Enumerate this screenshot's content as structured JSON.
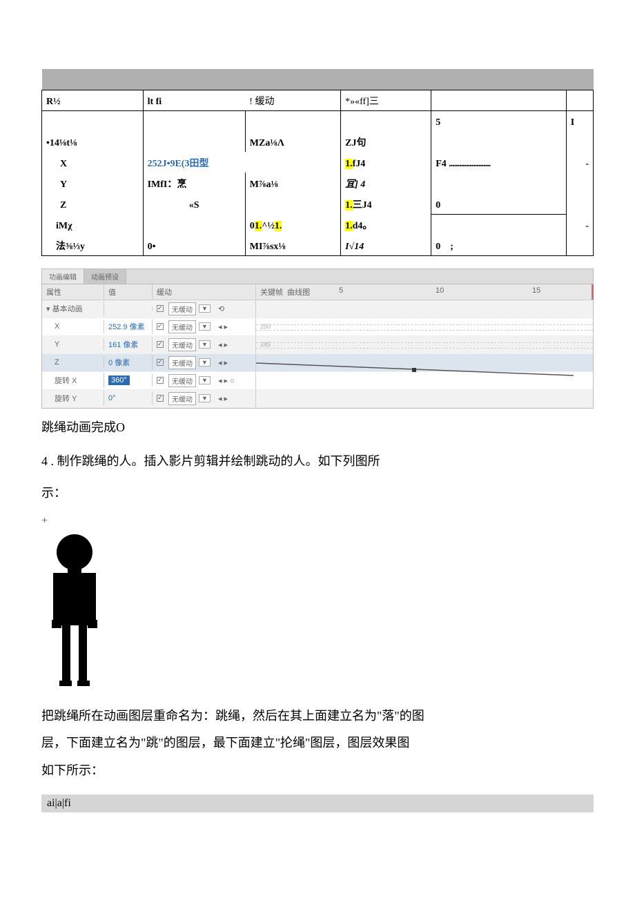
{
  "top_table": {
    "header_left": "R½",
    "header_mid1": "lt fi",
    "header_mid2": "! 缓动",
    "header_right": "*»«ff]三",
    "row0_right": "5",
    "row1_c1": "•14⅛t⅛",
    "row1_c3": "MZa⅛Λ",
    "row1_c4": "ZJ句",
    "row2_c1": "X",
    "row2_c2": "252J•9E(3田型",
    "row2_c3": "1.",
    "row2_c3b": "fJ4",
    "row2_c4": "F4",
    "row3_c1": "Y",
    "row3_c2a": "IMfI：烹",
    "row3_c2b": "M⅞a⅛",
    "row3_c3": "冝] 4",
    "row4_c1": "Z",
    "row4_c2": "«S",
    "row4_c3a": "1.",
    "row4_c3b": "三J4",
    "row4_c4": "0",
    "row5_c1": "iMχ",
    "row5_c2a": "0",
    "row5_c2b": "1.",
    "row5_c2c": "^½",
    "row5_c2d": "1.",
    "row5_c3a": "1.",
    "row5_c3b": "d4。",
    "row6_c1": "法⅜⅓y",
    "row6_c2": "0•",
    "row6_c3": "MI⅞sx⅛",
    "row6_c4": "I√14",
    "row6_c5": "0",
    "row6_c6": ";"
  },
  "anim": {
    "tab1": "功画编辑",
    "tab2": "动画预设",
    "head_c1": "属性",
    "head_c2": "值",
    "head_c3": "缓动",
    "head_c4a": "关键帧",
    "head_c4b": "曲线图",
    "scale_5": "5",
    "scale_10": "10",
    "scale_15": "15",
    "section": "▾ 基本动画",
    "ease_label": "无缓动",
    "row_x": "X",
    "row_x_val": "252.9 像素",
    "row_y": "Y",
    "row_y_val": "161 像素",
    "row_z": "Z",
    "row_z_val": "0 像素",
    "row_rx": "旋转 X",
    "row_rx_val": "360°",
    "row_ry": "旋转 Y",
    "row_ry_val": "0°",
    "graph_250": "250",
    "graph_245": "245"
  },
  "text": {
    "done": "跳绳动画完成O",
    "step4": "4 . 制作跳绳的人。插入影片剪辑并绘制跳动的人。如下列图所",
    "show": "示：",
    "plus": "+",
    "para1": "把跳绳所在动画图层重命名为：跳绳，然后在其上面建立名为\"落\"的图",
    "para2": "层，下面建立名为\"跳\"的图层，最下面建立\"抡绳\"图层，图层效果图",
    "para3": "如下所示：",
    "graybar": "ai|a|fi"
  }
}
